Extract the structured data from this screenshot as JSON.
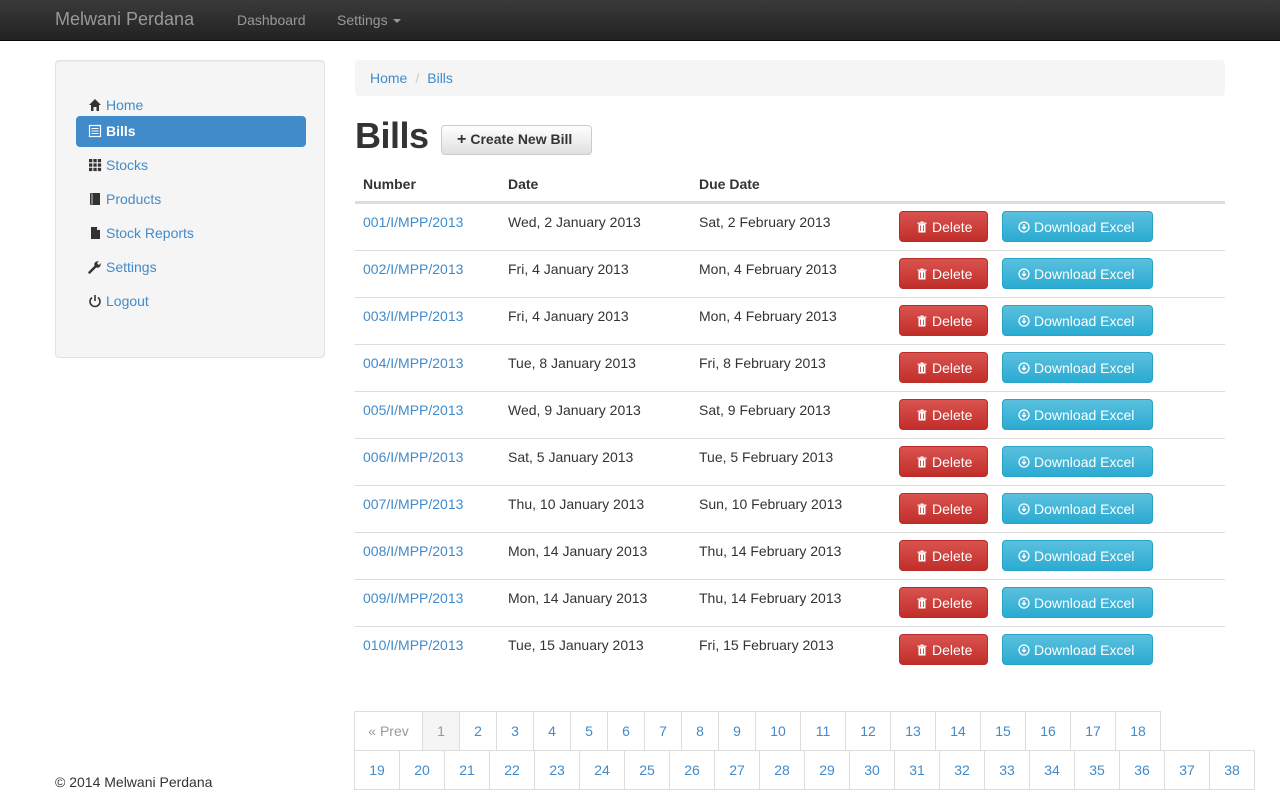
{
  "navbar": {
    "brand": "Melwani Perdana",
    "links": [
      {
        "label": "Dashboard"
      },
      {
        "label": "Settings"
      }
    ]
  },
  "sidebar": {
    "items": [
      {
        "label": "Home",
        "icon": "home-icon"
      },
      {
        "label": "Bills",
        "icon": "list-icon",
        "active": true
      },
      {
        "label": "Stocks",
        "icon": "grid-icon"
      },
      {
        "label": "Products",
        "icon": "book-icon"
      },
      {
        "label": "Stock Reports",
        "icon": "file-icon"
      },
      {
        "label": "Settings",
        "icon": "wrench-icon"
      },
      {
        "label": "Logout",
        "icon": "power-icon"
      }
    ]
  },
  "breadcrumb": [
    "Home",
    "Bills"
  ],
  "page": {
    "title": "Bills",
    "create_label": "Create New Bill"
  },
  "table": {
    "headers": [
      "Number",
      "Date",
      "Due Date"
    ],
    "delete_label": "Delete",
    "download_label": "Download Excel",
    "rows": [
      {
        "number": "001/I/MPP/2013",
        "date": "Wed, 2 January 2013",
        "due": "Sat, 2 February 2013"
      },
      {
        "number": "002/I/MPP/2013",
        "date": "Fri, 4 January 2013",
        "due": "Mon, 4 February 2013"
      },
      {
        "number": "003/I/MPP/2013",
        "date": "Fri, 4 January 2013",
        "due": "Mon, 4 February 2013"
      },
      {
        "number": "004/I/MPP/2013",
        "date": "Tue, 8 January 2013",
        "due": "Fri, 8 February 2013"
      },
      {
        "number": "005/I/MPP/2013",
        "date": "Wed, 9 January 2013",
        "due": "Sat, 9 February 2013"
      },
      {
        "number": "006/I/MPP/2013",
        "date": "Sat, 5 January 2013",
        "due": "Tue, 5 February 2013"
      },
      {
        "number": "007/I/MPP/2013",
        "date": "Thu, 10 January 2013",
        "due": "Sun, 10 February 2013"
      },
      {
        "number": "008/I/MPP/2013",
        "date": "Mon, 14 January 2013",
        "due": "Thu, 14 February 2013"
      },
      {
        "number": "009/I/MPP/2013",
        "date": "Mon, 14 January 2013",
        "due": "Thu, 14 February 2013"
      },
      {
        "number": "010/I/MPP/2013",
        "date": "Tue, 15 January 2013",
        "due": "Fri, 15 February 2013"
      }
    ]
  },
  "pagination": {
    "prev_label": "« Prev",
    "current": "1",
    "pages": [
      "1",
      "2",
      "3",
      "4",
      "5",
      "6",
      "7",
      "8",
      "9",
      "10",
      "11",
      "12",
      "13",
      "14",
      "15",
      "16",
      "17",
      "18",
      "19",
      "20",
      "21",
      "22",
      "23",
      "24",
      "25",
      "26",
      "27",
      "28",
      "29",
      "30",
      "31",
      "32",
      "33",
      "34",
      "35",
      "36",
      "37",
      "38"
    ]
  },
  "footer": "© 2014 Melwani Perdana"
}
